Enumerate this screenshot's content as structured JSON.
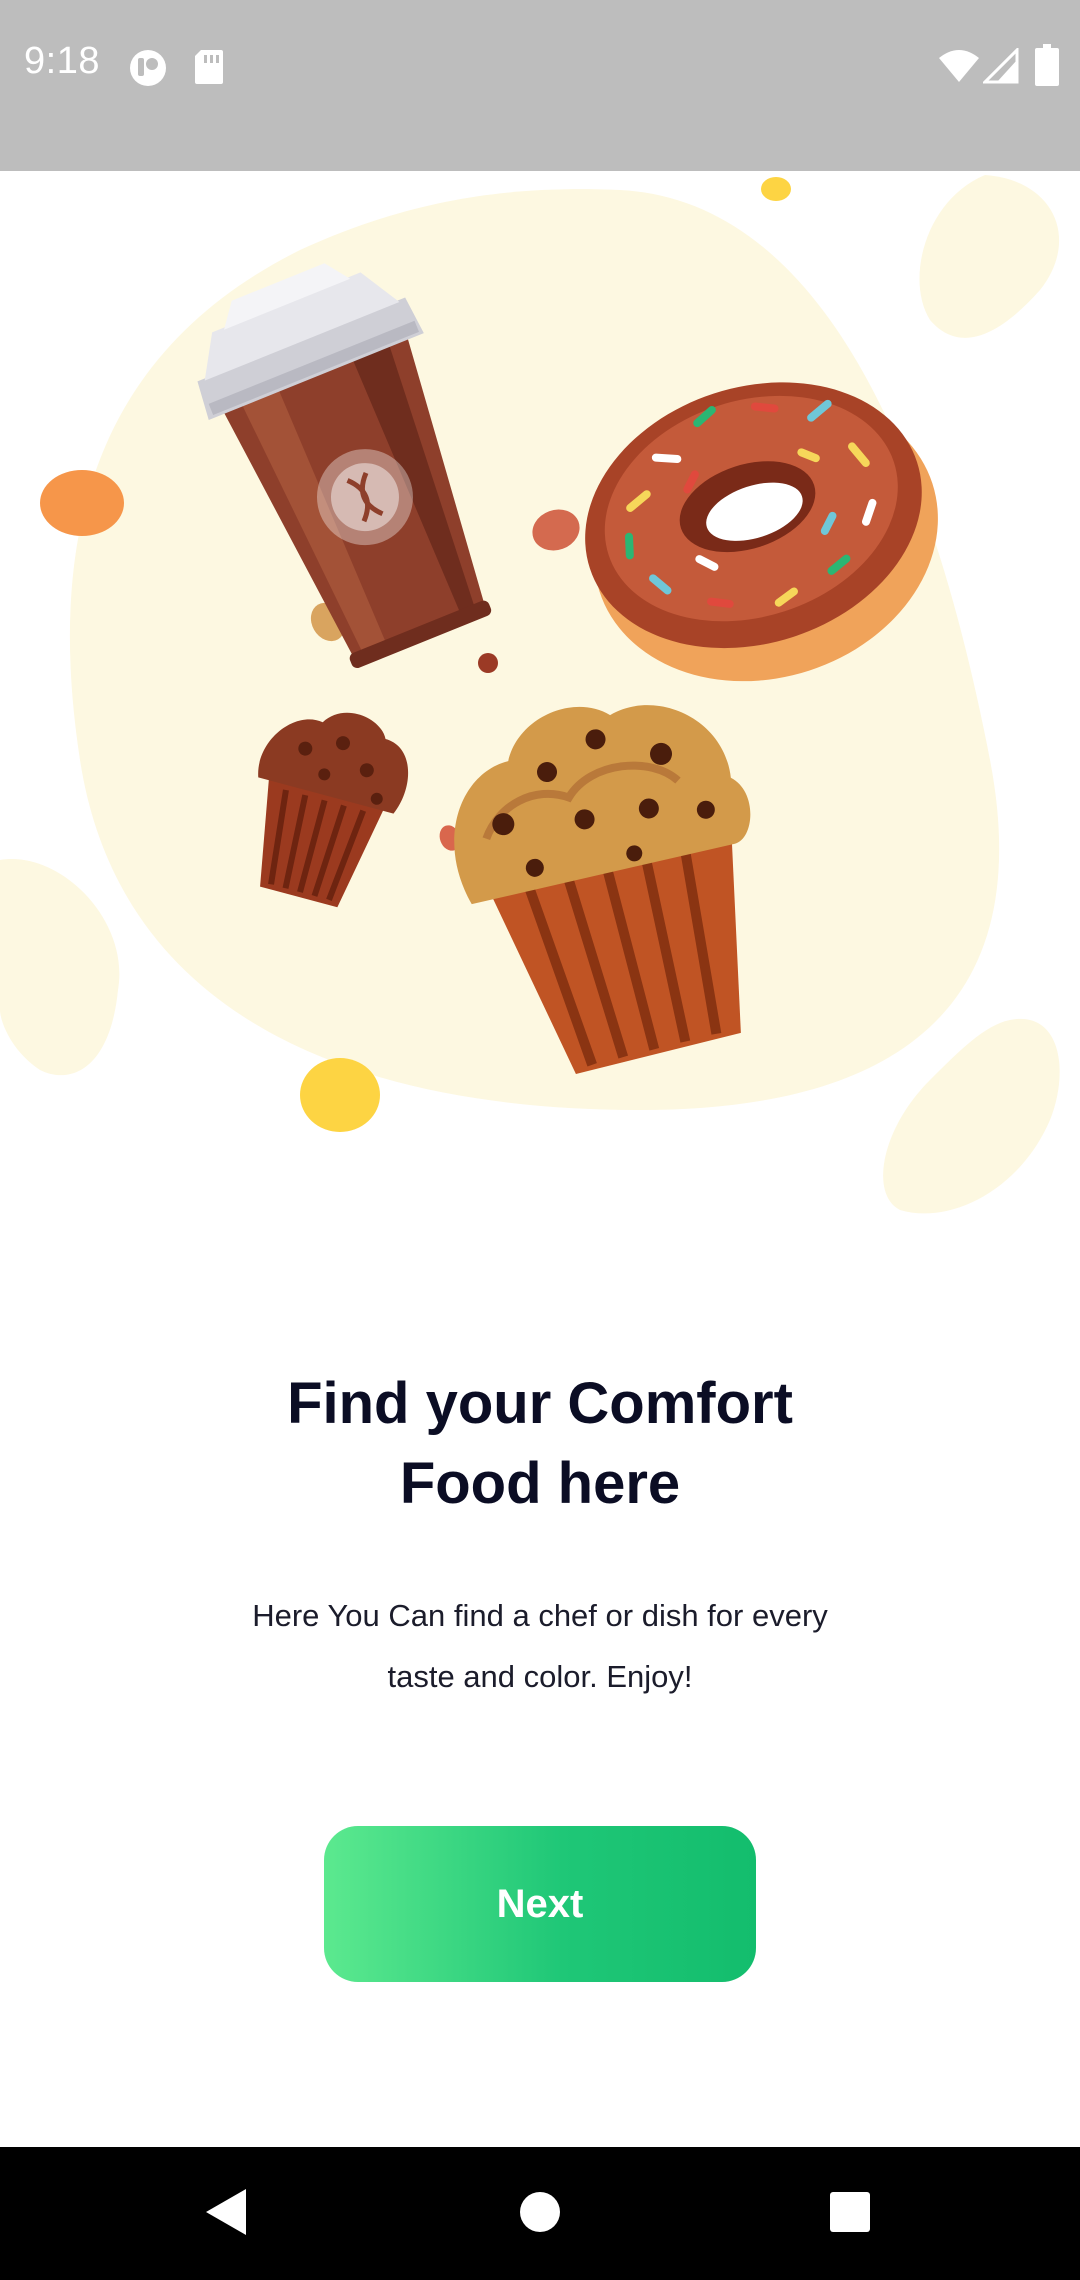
{
  "status_bar": {
    "time": "9:18",
    "left_icons": [
      "profile-badge-icon",
      "sd-card-icon"
    ],
    "right_icons": [
      "wifi-icon",
      "cellular-signal-icon",
      "battery-icon"
    ]
  },
  "illustration": {
    "items": [
      "coffee-cup",
      "donut",
      "small-muffin",
      "large-muffin"
    ],
    "colors": {
      "blob": "#fdf8e1",
      "coffee": "#8e3f2b",
      "donut_icing": "#a84327",
      "muffin_top": "#d39a4a",
      "accent_yellow": "#fdd443",
      "accent_orange": "#f6964a"
    }
  },
  "content": {
    "title_line1": "Find your Comfort",
    "title_line2": "Food here",
    "subtitle_line1": "Here You Can find a chef or dish for every",
    "subtitle_line2": "taste and color. Enjoy!"
  },
  "actions": {
    "next_label": "Next",
    "next_gradient": [
      "#5ce98f",
      "#13bd6d"
    ]
  },
  "nav_bar": {
    "buttons": [
      "back-icon",
      "home-icon",
      "recents-icon"
    ]
  }
}
